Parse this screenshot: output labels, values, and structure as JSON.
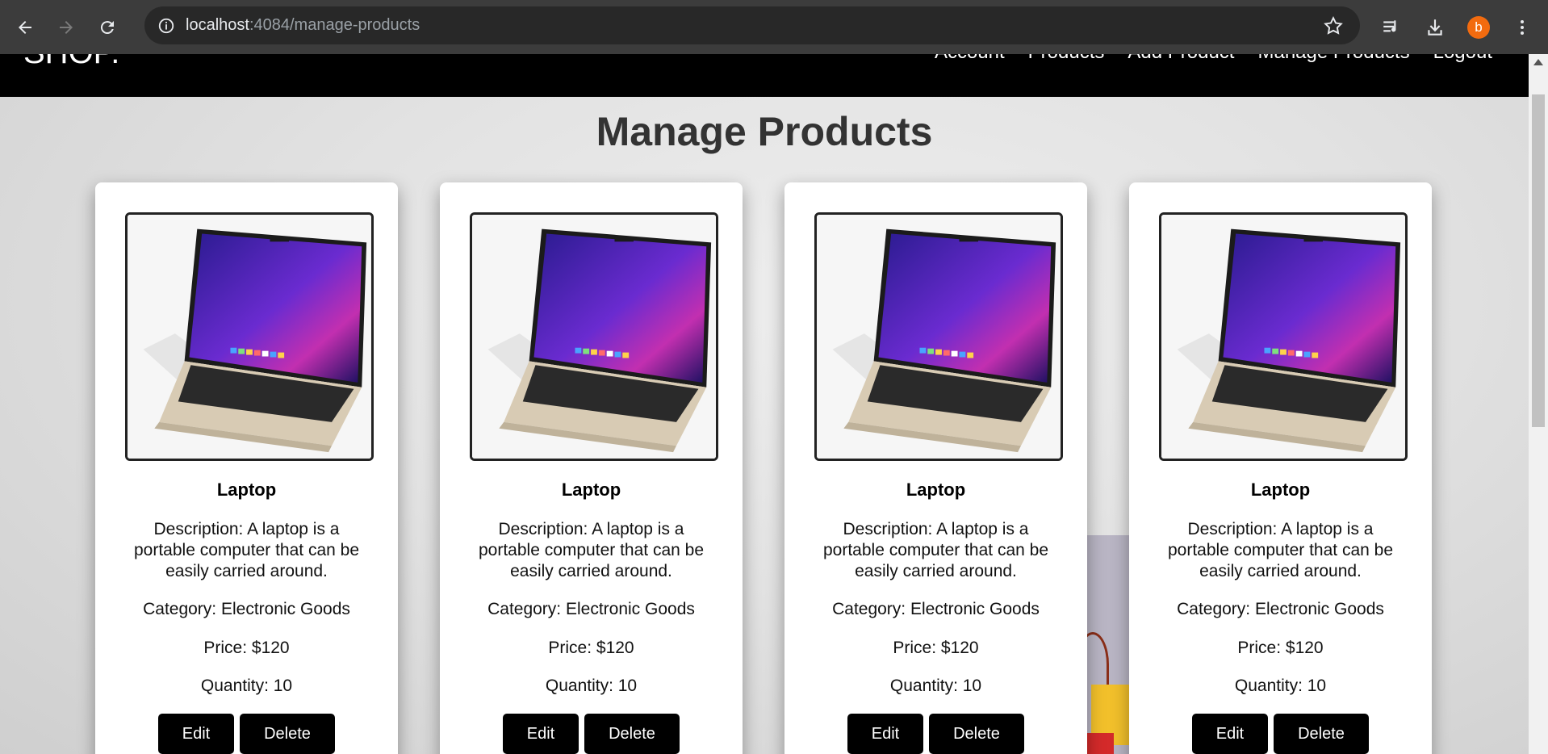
{
  "browser": {
    "url_host": "localhost",
    "url_path": ":4084/manage-products",
    "profile_initial": "b"
  },
  "site": {
    "brand": "SHOP.",
    "nav": [
      "Account",
      "Products",
      "Add Product",
      "Manage Products",
      "Logout"
    ]
  },
  "page": {
    "title": "Manage Products"
  },
  "products": [
    {
      "name": "Laptop",
      "description": "Description: A laptop is a portable computer that can be easily carried around.",
      "category": "Category: Electronic Goods",
      "price": "Price: $120",
      "quantity": "Quantity: 10",
      "edit_label": "Edit",
      "delete_label": "Delete"
    },
    {
      "name": "Laptop",
      "description": "Description: A laptop is a portable computer that can be easily carried around.",
      "category": "Category: Electronic Goods",
      "price": "Price: $120",
      "quantity": "Quantity: 10",
      "edit_label": "Edit",
      "delete_label": "Delete"
    },
    {
      "name": "Laptop",
      "description": "Description: A laptop is a portable computer that can be easily carried around.",
      "category": "Category: Electronic Goods",
      "price": "Price: $120",
      "quantity": "Quantity: 10",
      "edit_label": "Edit",
      "delete_label": "Delete"
    },
    {
      "name": "Laptop",
      "description": "Description: A laptop is a portable computer that can be easily carried around.",
      "category": "Category: Electronic Goods",
      "price": "Price: $120",
      "quantity": "Quantity: 10",
      "edit_label": "Edit",
      "delete_label": "Delete"
    }
  ],
  "icons": {
    "back": "back-arrow-icon",
    "forward": "forward-arrow-icon",
    "reload": "reload-icon",
    "site_info": "info-icon",
    "bookmark": "star-icon",
    "media": "media-queue-icon",
    "download": "download-icon",
    "menu": "kebab-menu-icon"
  }
}
